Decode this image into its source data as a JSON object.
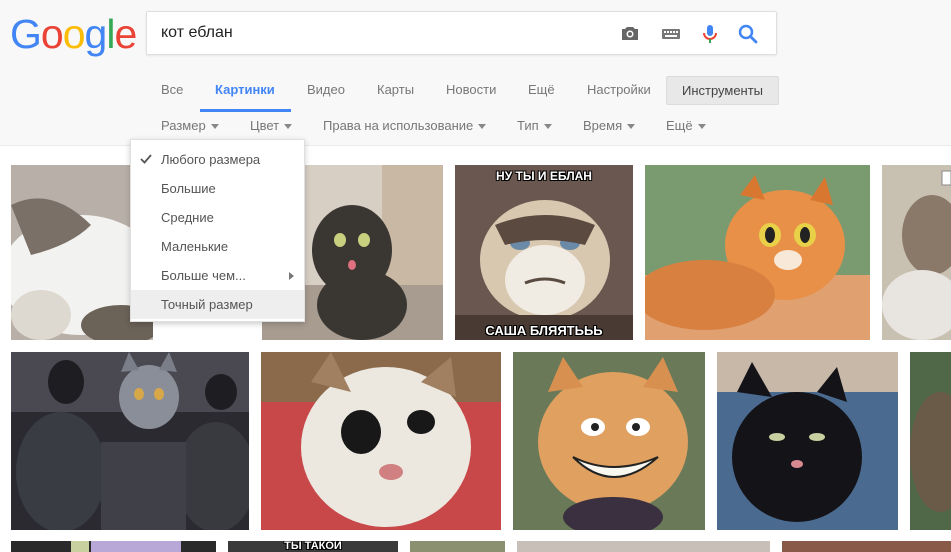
{
  "logo": {
    "letters": [
      "G",
      "o",
      "o",
      "g",
      "l",
      "e"
    ],
    "colors": [
      "#4285f4",
      "#ea4335",
      "#fbbc05",
      "#4285f4",
      "#34a853",
      "#ea4335"
    ]
  },
  "search": {
    "query": "кот еблан",
    "icons": [
      "camera-icon",
      "keyboard-icon",
      "microphone-icon",
      "search-icon"
    ]
  },
  "tabs": [
    {
      "label": "Все",
      "active": false
    },
    {
      "label": "Картинки",
      "active": true
    },
    {
      "label": "Видео",
      "active": false
    },
    {
      "label": "Карты",
      "active": false
    },
    {
      "label": "Новости",
      "active": false
    },
    {
      "label": "Ещё",
      "active": false
    },
    {
      "label": "Настройки",
      "active": false
    }
  ],
  "tools_label": "Инструменты",
  "filters": [
    {
      "label": "Размер"
    },
    {
      "label": "Цвет"
    },
    {
      "label": "Права на использование"
    },
    {
      "label": "Тип"
    },
    {
      "label": "Время"
    },
    {
      "label": "Ещё"
    }
  ],
  "size_menu": {
    "items": [
      {
        "label": "Любого размера",
        "checked": true
      },
      {
        "label": "Большие"
      },
      {
        "label": "Средние"
      },
      {
        "label": "Маленькие"
      },
      {
        "label": "Больше чем...",
        "submenu": true
      },
      {
        "label": "Точный размер",
        "hovered": true
      }
    ]
  },
  "image_captions": {
    "grumpy_top": "НУ ТЫ И ЕБЛАН",
    "grumpy_bottom": "САША БЛЯЯТЬЬЬ",
    "bottom_row_partial": "ТЫ ТАКОЙ"
  },
  "accent": "#4285f4"
}
